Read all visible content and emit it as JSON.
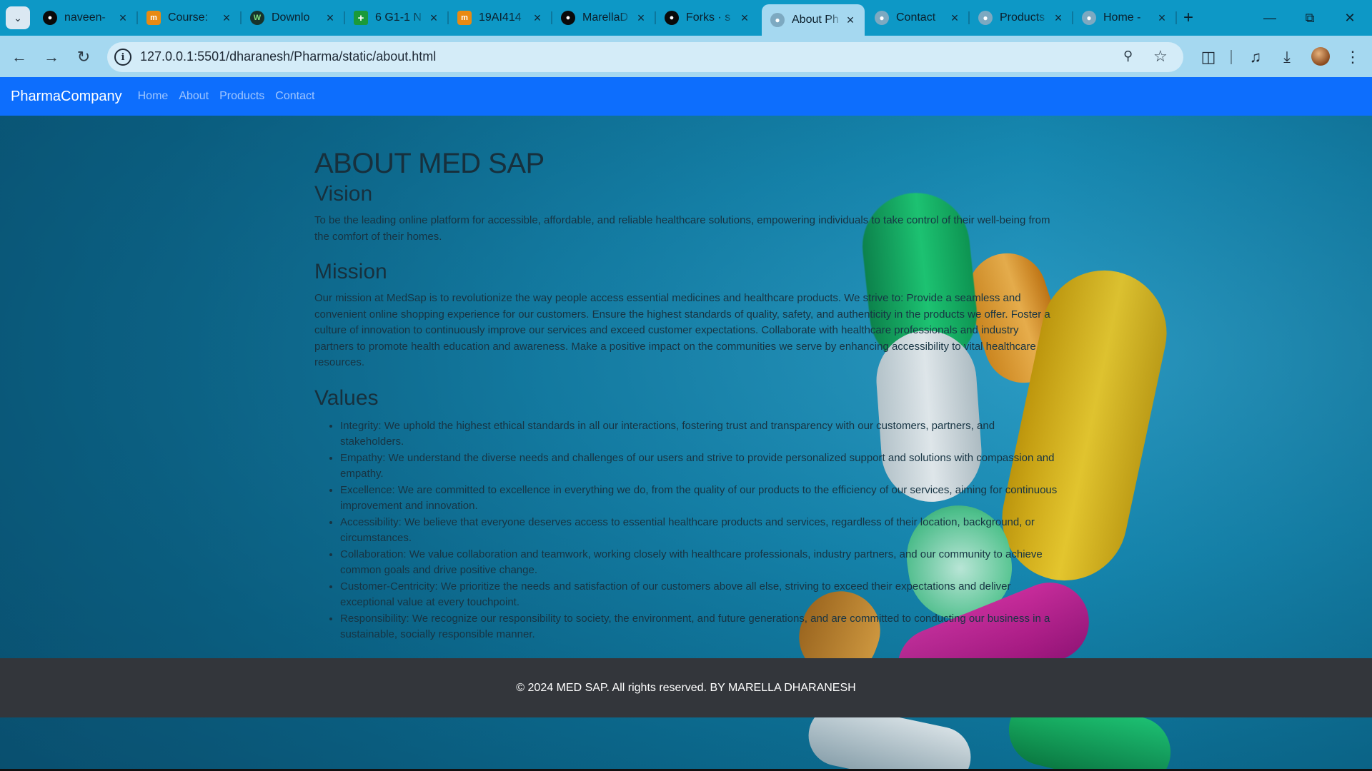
{
  "browser": {
    "tabs": [
      {
        "label": "naveen-",
        "favicon": "github-icon",
        "active": false
      },
      {
        "label": "Course:",
        "favicon": "coursera-icon",
        "active": false
      },
      {
        "label": "Downlo",
        "favicon": "w-icon",
        "active": false
      },
      {
        "label": "6 G1-1 N",
        "favicon": "plus-icon",
        "active": false
      },
      {
        "label": "19AI414",
        "favicon": "coursera-icon",
        "active": false
      },
      {
        "label": "MarellaD",
        "favicon": "github-icon",
        "active": false
      },
      {
        "label": "Forks · s",
        "favicon": "github-icon",
        "active": false
      },
      {
        "label": "About Ph",
        "favicon": "globe-icon",
        "active": true
      },
      {
        "label": "Contact",
        "favicon": "globe-icon",
        "active": false
      },
      {
        "label": "Products",
        "favicon": "globe-icon",
        "active": false
      },
      {
        "label": "Home -",
        "favicon": "globe-icon",
        "active": false
      }
    ],
    "url": "127.0.0.1:5501/dharanesh/Pharma/static/about.html"
  },
  "navbar": {
    "brand": "PharmaCompany",
    "links": [
      "Home",
      "About",
      "Products",
      "Contact"
    ]
  },
  "content": {
    "title": "ABOUT MED SAP",
    "vision_heading": "Vision",
    "vision_text": "To be the leading online platform for accessible, affordable, and reliable healthcare solutions, empowering individuals to take control of their well-being from the comfort of their homes.",
    "mission_heading": "Mission",
    "mission_text": "Our mission at MedSap is to revolutionize the way people access essential medicines and healthcare products. We strive to: Provide a seamless and convenient online shopping experience for our customers. Ensure the highest standards of quality, safety, and authenticity in the products we offer. Foster a culture of innovation to continuously improve our services and exceed customer expectations. Collaborate with healthcare professionals and industry partners to promote health education and awareness. Make a positive impact on the communities we serve by enhancing accessibility to vital healthcare resources.",
    "values_heading": "Values",
    "values": [
      "Integrity: We uphold the highest ethical standards in all our interactions, fostering trust and transparency with our customers, partners, and stakeholders.",
      "Empathy: We understand the diverse needs and challenges of our users and strive to provide personalized support and solutions with compassion and empathy.",
      "Excellence: We are committed to excellence in everything we do, from the quality of our products to the efficiency of our services, aiming for continuous improvement and innovation.",
      "Accessibility: We believe that everyone deserves access to essential healthcare products and services, regardless of their location, background, or circumstances.",
      "Collaboration: We value collaboration and teamwork, working closely with healthcare professionals, industry partners, and our community to achieve common goals and drive positive change.",
      "Customer-Centricity: We prioritize the needs and satisfaction of our customers above all else, striving to exceed their expectations and deliver exceptional value at every touchpoint.",
      "Responsibility: We recognize our responsibility to society, the environment, and future generations, and are committed to conducting our business in a sustainable, socially responsible manner."
    ]
  },
  "footer": {
    "text": "© 2024 MED SAP. All rights reserved. BY MARELLA DHARANESH"
  },
  "colors": {
    "navbar": "#0d6efd",
    "footer": "#33363b",
    "tabstrip": "#0d98c6",
    "toolbar": "#a5d8f0"
  }
}
